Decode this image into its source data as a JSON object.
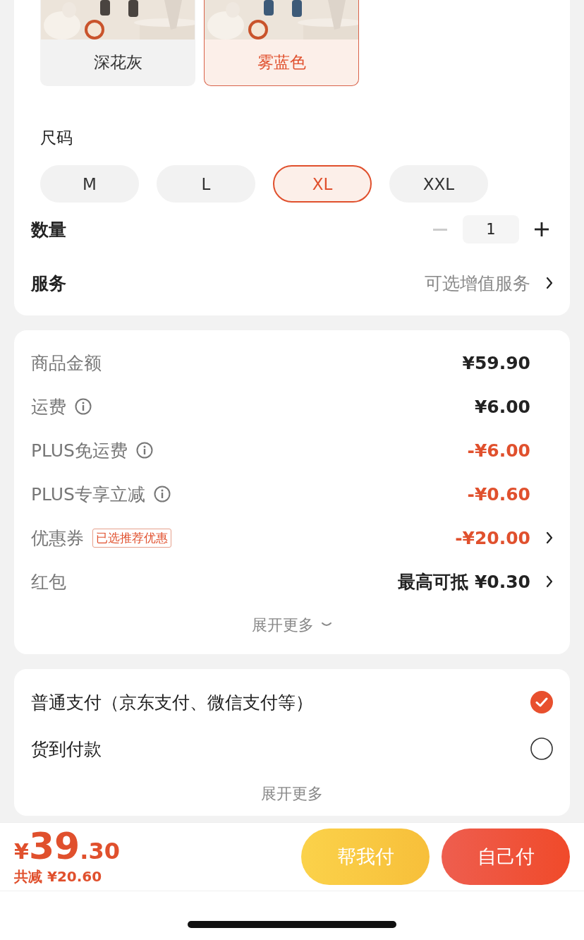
{
  "variants": [
    {
      "label": "深花灰",
      "selected": false
    },
    {
      "label": "雾蓝色",
      "selected": true
    }
  ],
  "size": {
    "heading": "尺码",
    "options": [
      {
        "label": "M",
        "selected": false
      },
      {
        "label": "L",
        "selected": false
      },
      {
        "label": "XL",
        "selected": true
      },
      {
        "label": "XXL",
        "selected": false
      }
    ]
  },
  "quantity": {
    "label": "数量",
    "value": "1",
    "minus_disabled": true
  },
  "service": {
    "label": "服务",
    "value": "可选增值服务"
  },
  "summary": {
    "rows": [
      {
        "label": "商品金额",
        "info": false,
        "amount": "¥59.90",
        "kind": "total",
        "arrow": false
      },
      {
        "label": "运费",
        "info": true,
        "amount": "¥6.00",
        "kind": "total",
        "arrow": false
      },
      {
        "label": "PLUS免运费",
        "info": true,
        "amount": "-¥6.00",
        "kind": "discount",
        "arrow": false
      },
      {
        "label": "PLUS专享立减",
        "info": true,
        "amount": "-¥0.60",
        "kind": "discount",
        "arrow": false
      },
      {
        "label": "优惠券",
        "info": false,
        "tag": "已选推荐优惠",
        "amount": "-¥20.00",
        "kind": "discount",
        "arrow": true
      },
      {
        "label": "红包",
        "info": false,
        "amount": "最高可抵 ¥0.30",
        "kind": "total",
        "arrow": true
      }
    ],
    "expand": "展开更多"
  },
  "payment": {
    "options": [
      {
        "label": "普通支付（京东支付、微信支付等）",
        "selected": true
      },
      {
        "label": "货到付款",
        "selected": false
      }
    ],
    "expand": "展开更多"
  },
  "footer": {
    "currency": "¥",
    "integer": "39",
    "decimal": ".30",
    "savings": "共减 ¥20.60",
    "buttons": [
      {
        "label": "帮我付",
        "kind": "secondary"
      },
      {
        "label": "自己付",
        "kind": "primary"
      }
    ]
  }
}
